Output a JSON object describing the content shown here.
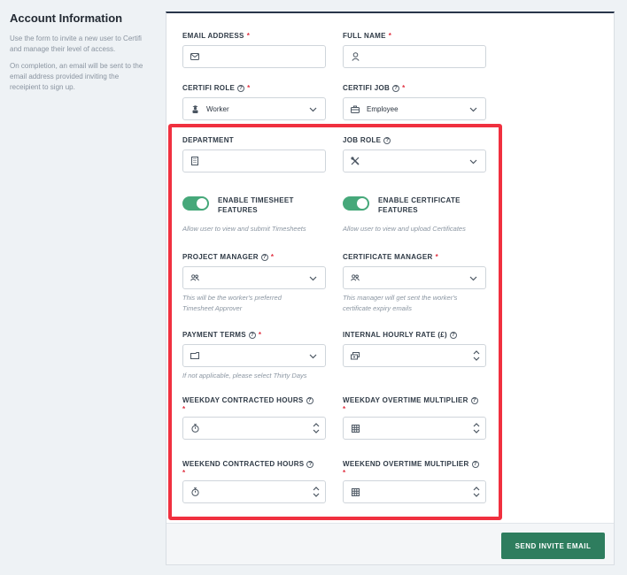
{
  "sidebar": {
    "title": "Account Information",
    "desc1": "Use the form to invite a new user to Certifi and manage their level of access.",
    "desc2": "On completion, an email will be sent to the email address provided inviting the receipient to sign up."
  },
  "form": {
    "email": {
      "label": "EMAIL ADDRESS",
      "required": "*",
      "value": ""
    },
    "full_name": {
      "label": "FULL NAME",
      "required": "*",
      "value": ""
    },
    "certifi_role": {
      "label": "CERTIFI ROLE",
      "required": "*",
      "value": "Worker"
    },
    "certifi_job": {
      "label": "CERTIFI JOB",
      "required": "*",
      "value": "Employee"
    },
    "department": {
      "label": "DEPARTMENT",
      "value": ""
    },
    "job_role": {
      "label": "JOB ROLE",
      "value": ""
    },
    "timesheet_toggle": {
      "label": "ENABLE TIMESHEET FEATURES",
      "help": "Allow user to view and submit Timesheets",
      "on": true
    },
    "certificate_toggle": {
      "label": "ENABLE CERTIFICATE FEATURES",
      "help": "Allow user to view and upload Certificates",
      "on": true
    },
    "project_manager": {
      "label": "PROJECT MANAGER",
      "required": "*",
      "help": "This will be the worker's preferred Timesheet Approver"
    },
    "certificate_manager": {
      "label": "CERTIFICATE MANAGER",
      "required": "*",
      "help": "This manager will get sent the worker's certificate expiry emails"
    },
    "payment_terms": {
      "label": "PAYMENT TERMS",
      "required": "*",
      "help": "If not applicable, please select Thirty Days"
    },
    "hourly_rate": {
      "label": "INTERNAL HOURLY RATE (£)"
    },
    "weekday_hours": {
      "label": "WEEKDAY CONTRACTED HOURS",
      "required": "*"
    },
    "weekday_multiplier": {
      "label": "WEEKDAY OVERTIME MULTIPLIER",
      "required": "*"
    },
    "weekend_hours": {
      "label": "WEEKEND CONTRACTED HOURS",
      "required": "*"
    },
    "weekend_multiplier": {
      "label": "WEEKEND OVERTIME MULTIPLIER",
      "required": "*"
    }
  },
  "footer": {
    "send_label": "SEND INVITE EMAIL"
  },
  "help_glyph": "?",
  "colors": {
    "accent": "#2e7d5e",
    "toggle_on": "#46a87a",
    "highlight": "#f0303f",
    "required": "#e03040"
  }
}
